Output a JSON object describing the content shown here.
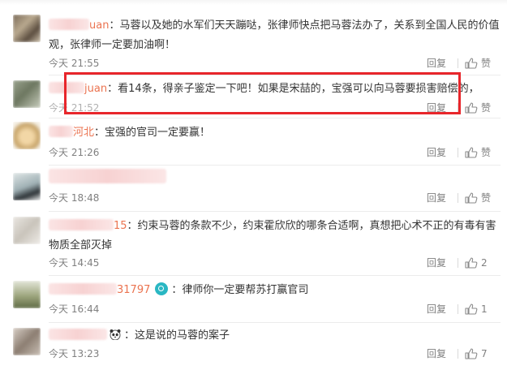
{
  "colors": {
    "username": "#eb7350",
    "meta": "#808080",
    "highlight": "#e8262b"
  },
  "comments": [
    {
      "username_suffix": "uan",
      "text": "：马蓉以及她的水军们天天蹦哒，张律师快点把马蓉法办了，关系到全国人民的价值",
      "text2": "观，张律师一定要加油啊！",
      "time": "今天 21:55",
      "reply": "回复",
      "like": "赞"
    },
    {
      "username_suffix": "juan",
      "text": "：看14条，得亲子鉴定一下吧！如果是宋喆的，宝强可以向马蓉要损害赔偿的，",
      "time": "今天 21:52",
      "reply": "回复",
      "like": "赞"
    },
    {
      "username_suffix": "河北",
      "text": "：宝强的官司一定要赢！",
      "time": "今天 21:26",
      "reply": "回复",
      "like": "赞"
    },
    {
      "username_suffix": "",
      "text": "",
      "time": "今天 18:48",
      "reply": "回复",
      "like": "赞"
    },
    {
      "username_suffix": "15",
      "text": "：约束马蓉的条款不少，约束霍欣欣的哪条合适啊，真想把心术不正的有毒有害",
      "text2": "物质全部灭掉",
      "time": "今天 14:45",
      "reply": "回复",
      "like": "2"
    },
    {
      "username_suffix": "31797",
      "text": "：律师你一定要帮苏打赢官司",
      "time": "今天 16:44",
      "reply": "回复",
      "like": "1"
    },
    {
      "username_suffix": "",
      "text": "：这是说的马蓉的案子",
      "time": "今天 13:23",
      "reply": "回复",
      "like": "7"
    }
  ]
}
